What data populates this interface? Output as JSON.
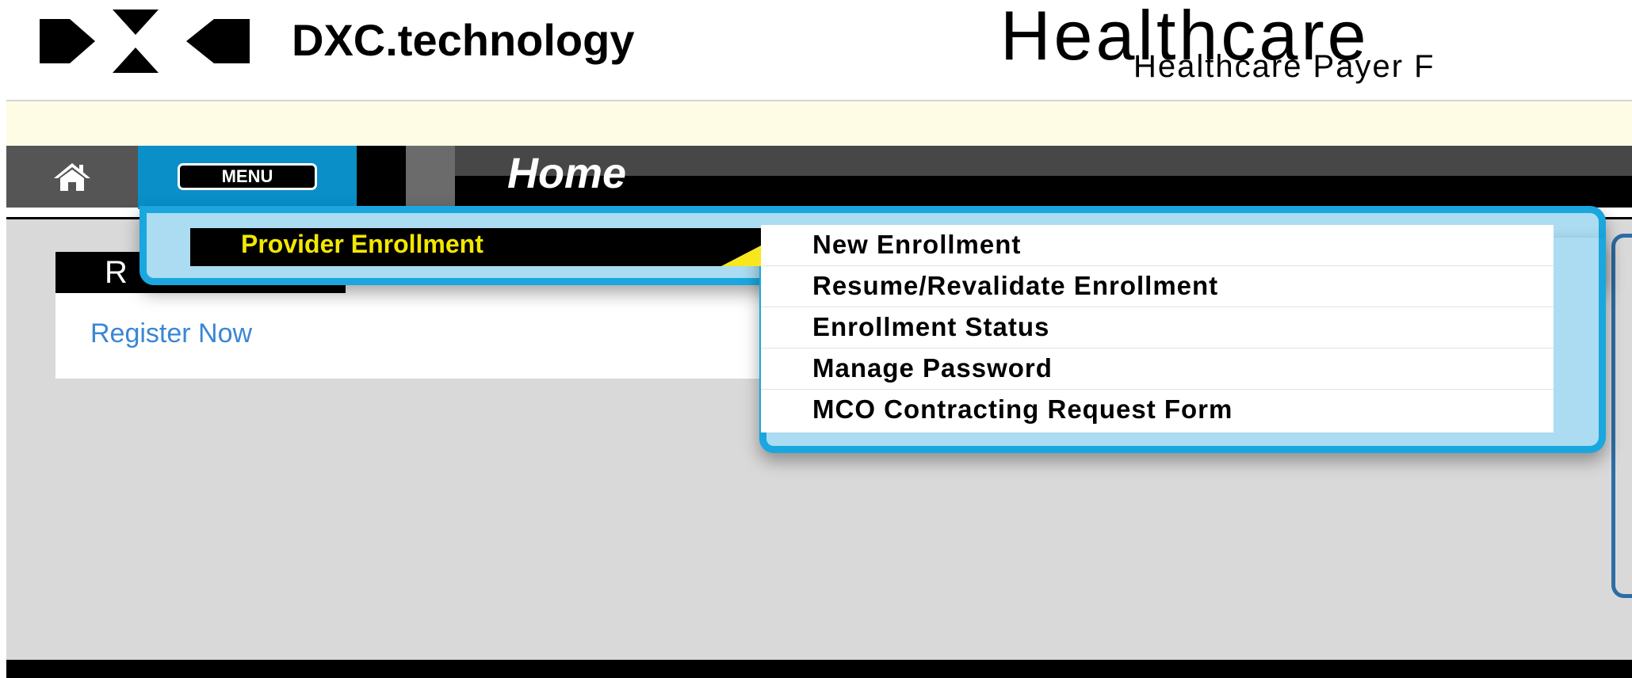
{
  "header": {
    "brand_name": "DXC.technology",
    "app_title": "Healthcare",
    "app_subtitle": "Healthcare Payer F"
  },
  "nav": {
    "home_icon": "home-icon",
    "menu_label": "MENU",
    "page_title": "Home"
  },
  "main": {
    "panel_header": "R",
    "register_link": "Register Now"
  },
  "dropdown": {
    "category_label": "Provider Enrollment",
    "items": [
      {
        "label": "New Enrollment"
      },
      {
        "label": "Resume/Revalidate Enrollment"
      },
      {
        "label": "Enrollment Status"
      },
      {
        "label": "Manage Password"
      },
      {
        "label": "MCO Contracting Request Form"
      }
    ]
  },
  "colors": {
    "menu_blue": "#0a8fc9",
    "dropdown_border": "#1aa7df",
    "dropdown_fill": "#abdcf1",
    "category_text": "#f3e800",
    "link_blue": "#3a86d6",
    "notice_bar": "#fffce6"
  }
}
